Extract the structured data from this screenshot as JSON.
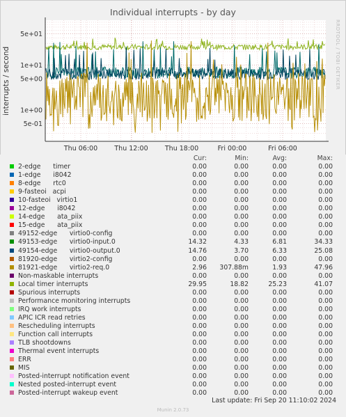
{
  "title": "Individual interrupts - by day",
  "side_label": "RRDTOOL / TOBI OETIKER",
  "chart_data": {
    "type": "line",
    "title": "Individual interrupts - by day",
    "ylabel": "interrupts / second",
    "yscale": "log",
    "ylim": [
      0.2,
      100
    ],
    "y_ticks": [
      {
        "value": 50,
        "label": "5e+01"
      },
      {
        "value": 10,
        "label": "1e+01"
      },
      {
        "value": 5,
        "label": "5e+00"
      },
      {
        "value": 1,
        "label": "1e+00"
      },
      {
        "value": 0.5,
        "label": "5e-01"
      }
    ],
    "x_ticks": [
      "Thu 06:00",
      "Thu 12:00",
      "Thu 18:00",
      "Fri 00:00",
      "Fri 06:00"
    ],
    "grid": true,
    "series": [
      {
        "name": "Local timer interrupts",
        "color": "#8fb31f",
        "min": 18.82,
        "avg": 25.23,
        "max": 41.07,
        "cur": 29.95
      },
      {
        "name": "49153-edge virtio0-input.0",
        "color": "#006b6b",
        "min": 4.33,
        "avg": 6.81,
        "max": 34.33,
        "cur": 14.32
      },
      {
        "name": "49154-edge virtio0-output.0",
        "color": "#00435e",
        "min": 3.7,
        "avg": 6.33,
        "max": 25.08,
        "cur": 14.76
      },
      {
        "name": "81921-edge virtio2-req.0",
        "color": "#b8900a",
        "min": 0.30788,
        "avg": 1.93,
        "max": 47.96,
        "cur": 2.96
      }
    ]
  },
  "legend": {
    "headers": [
      "Cur:",
      "Min:",
      "Avg:",
      "Max:"
    ],
    "rows": [
      {
        "label": "2-edge      timer",
        "color": "#00cc00",
        "cur": "0.00",
        "min": "0.00",
        "avg": "0.00",
        "max": "0.00"
      },
      {
        "label": "1-edge      i8042",
        "color": "#0066b3",
        "cur": "0.00",
        "min": "0.00",
        "avg": "0.00",
        "max": "0.00"
      },
      {
        "label": "8-edge      rtc0",
        "color": "#ff8000",
        "cur": "0.00",
        "min": "0.00",
        "avg": "0.00",
        "max": "0.00"
      },
      {
        "label": "9-fasteoi   acpi",
        "color": "#ffcc00",
        "cur": "0.00",
        "min": "0.00",
        "avg": "0.00",
        "max": "0.00"
      },
      {
        "label": "10-fasteoi   virtio1",
        "color": "#330099",
        "cur": "0.00",
        "min": "0.00",
        "avg": "0.00",
        "max": "0.00"
      },
      {
        "label": "12-edge      i8042",
        "color": "#990099",
        "cur": "0.00",
        "min": "0.00",
        "avg": "0.00",
        "max": "0.00"
      },
      {
        "label": "14-edge      ata_piix",
        "color": "#ccff00",
        "cur": "0.00",
        "min": "0.00",
        "avg": "0.00",
        "max": "0.00"
      },
      {
        "label": "15-edge      ata_piix",
        "color": "#ff0000",
        "cur": "0.00",
        "min": "0.00",
        "avg": "0.00",
        "max": "0.00"
      },
      {
        "label": "49152-edge      virtio0-config",
        "color": "#808080",
        "cur": "0.00",
        "min": "0.00",
        "avg": "0.00",
        "max": "0.00"
      },
      {
        "label": "49153-edge      virtio0-input.0",
        "color": "#008f00",
        "cur": "14.32",
        "min": "4.33",
        "avg": "6.81",
        "max": "34.33"
      },
      {
        "label": "49154-edge      virtio0-output.0",
        "color": "#00487d",
        "cur": "14.76",
        "min": "3.70",
        "avg": "6.33",
        "max": "25.08"
      },
      {
        "label": "81920-edge      virtio2-config",
        "color": "#b35a00",
        "cur": "0.00",
        "min": "0.00",
        "avg": "0.00",
        "max": "0.00"
      },
      {
        "label": "81921-edge      virtio2-req.0",
        "color": "#b38f00",
        "cur": "2.96",
        "min": "307.88m",
        "avg": "1.93",
        "max": "47.96"
      },
      {
        "label": "Non-maskable interrupts",
        "color": "#6b006b",
        "cur": "0.00",
        "min": "0.00",
        "avg": "0.00",
        "max": "0.00"
      },
      {
        "label": "Local timer interrupts",
        "color": "#8fb300",
        "cur": "29.95",
        "min": "18.82",
        "avg": "25.23",
        "max": "41.07"
      },
      {
        "label": "Spurious interrupts",
        "color": "#b30000",
        "cur": "0.00",
        "min": "0.00",
        "avg": "0.00",
        "max": "0.00"
      },
      {
        "label": "Performance monitoring interrupts",
        "color": "#bebebe",
        "cur": "0.00",
        "min": "0.00",
        "avg": "0.00",
        "max": "0.00"
      },
      {
        "label": "IRQ work interrupts",
        "color": "#80ff80",
        "cur": "0.00",
        "min": "0.00",
        "avg": "0.00",
        "max": "0.00"
      },
      {
        "label": "APIC ICR read retries",
        "color": "#80c9ff",
        "cur": "0.00",
        "min": "0.00",
        "avg": "0.00",
        "max": "0.00"
      },
      {
        "label": "Rescheduling interrupts",
        "color": "#ffc080",
        "cur": "0.00",
        "min": "0.00",
        "avg": "0.00",
        "max": "0.00"
      },
      {
        "label": "Function call interrupts",
        "color": "#ffe680",
        "cur": "0.00",
        "min": "0.00",
        "avg": "0.00",
        "max": "0.00"
      },
      {
        "label": "TLB shootdowns",
        "color": "#aa80ff",
        "cur": "0.00",
        "min": "0.00",
        "avg": "0.00",
        "max": "0.00"
      },
      {
        "label": "Thermal event interrupts",
        "color": "#ee00cc",
        "cur": "0.00",
        "min": "0.00",
        "avg": "0.00",
        "max": "0.00"
      },
      {
        "label": "ERR",
        "color": "#ff8080",
        "cur": "0.00",
        "min": "0.00",
        "avg": "0.00",
        "max": "0.00"
      },
      {
        "label": "MIS",
        "color": "#666600",
        "cur": "0.00",
        "min": "0.00",
        "avg": "0.00",
        "max": "0.00"
      },
      {
        "label": "Posted-interrupt notification event",
        "color": "#ffbfff",
        "cur": "0.00",
        "min": "0.00",
        "avg": "0.00",
        "max": "0.00"
      },
      {
        "label": "Nested posted-interrupt event",
        "color": "#00ffcc",
        "cur": "0.00",
        "min": "0.00",
        "avg": "0.00",
        "max": "0.00"
      },
      {
        "label": "Posted-interrupt wakeup event",
        "color": "#cc6699",
        "cur": "0.00",
        "min": "0.00",
        "avg": "0.00",
        "max": "0.00"
      }
    ]
  },
  "last_update": "Last update: Fri Sep 20 11:10:02 2024",
  "footer": "Munin 2.0.73"
}
